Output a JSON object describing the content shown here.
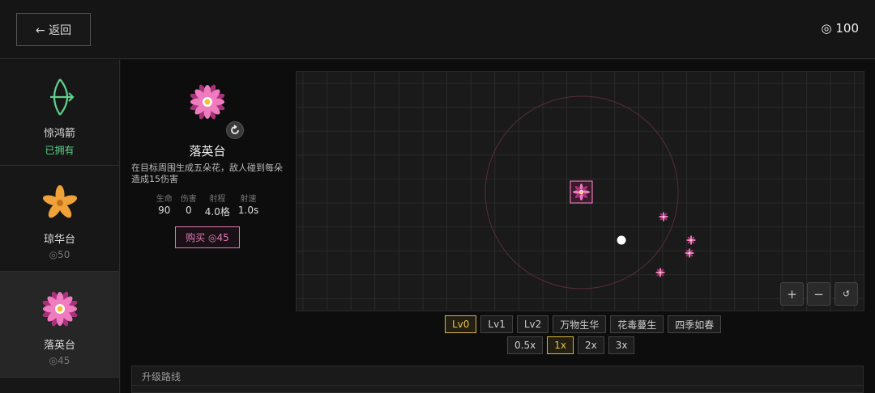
{
  "header": {
    "back_label": "← 返回",
    "coin_icon": "coin-ring-icon",
    "coins": "◎ 100"
  },
  "sidebar": {
    "items": [
      {
        "name": "惊鸿箭",
        "sub": "已拥有",
        "icon": "bow-arrow-icon",
        "color": "#5fd18a"
      },
      {
        "name": "琼华台",
        "sub": "◎50",
        "icon": "orange-flower-icon",
        "color": "#f0a23a"
      },
      {
        "name": "落英台",
        "sub": "◎45",
        "icon": "pink-flower-icon",
        "color": "#e05aa8"
      }
    ]
  },
  "tower": {
    "name": "落英台",
    "description": "在目标周围生成五朵花，敌人碰到每朵造成15伤害",
    "stats": [
      {
        "label": "生命",
        "value": "90"
      },
      {
        "label": "伤害",
        "value": "0"
      },
      {
        "label": "射程",
        "value": "4.0格"
      },
      {
        "label": "射速",
        "value": "1.0s"
      }
    ],
    "buy_label": "购买 ◎45",
    "accent": "#e07ab4"
  },
  "field": {
    "zoom_in": "+",
    "zoom_out": "−",
    "reset": "↺"
  },
  "levels": [
    "Lv0",
    "Lv1",
    "Lv2",
    "万物生华",
    "花毒蔓生",
    "四季如春"
  ],
  "active_level": "Lv0",
  "speeds": [
    "0.5x",
    "1x",
    "2x",
    "3x"
  ],
  "active_speed": "1x",
  "upgrade": {
    "title": "升级路线"
  }
}
